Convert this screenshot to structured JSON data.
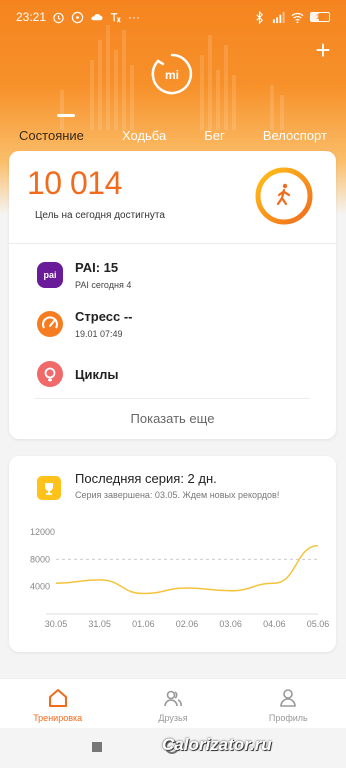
{
  "status_bar": {
    "time": "23:21",
    "more_dots": "···",
    "battery": "16"
  },
  "tabs": [
    {
      "label": "Состояние",
      "active": true
    },
    {
      "label": "Ходьба",
      "active": false
    },
    {
      "label": "Бег",
      "active": false
    },
    {
      "label": "Велоспорт",
      "active": false
    }
  ],
  "steps": {
    "value": "10 014",
    "subtitle": "Цель на сегодня достигнута"
  },
  "rows": [
    {
      "icon": "pai-icon",
      "title": "PAI: 15",
      "subtitle": "PAI сегодня 4",
      "icon_label": "pai"
    },
    {
      "icon": "stress-gauge-icon",
      "title": "Стресс --",
      "subtitle": "19.01 07:49"
    },
    {
      "icon": "cycles-icon",
      "title": "Циклы",
      "subtitle": ""
    }
  ],
  "show_more": "Показать еще",
  "streak": {
    "title": "Последняя серия: 2 дн.",
    "subtitle": "Серия завершена: 03.05. Ждем новых рекордов!"
  },
  "chart_data": {
    "type": "line",
    "x": [
      "30.05",
      "31.05",
      "01.06",
      "02.06",
      "03.06",
      "04.06",
      "05.06"
    ],
    "values": [
      4500,
      5000,
      3000,
      3800,
      3400,
      4500,
      10000
    ],
    "yticks": [
      "12000",
      "8000",
      "4000"
    ],
    "ylim": [
      0,
      12000
    ],
    "goal_line": 8000,
    "xlabel": "",
    "ylabel": ""
  },
  "bottom_nav": [
    {
      "label": "Тренировка",
      "active": true
    },
    {
      "label": "Друзья",
      "active": false
    },
    {
      "label": "Профиль",
      "active": false
    }
  ],
  "watermark": "Calorizator.ru",
  "colors": {
    "accent": "#f26b1d",
    "header": "#f5841f",
    "pai": "#6a1b9a",
    "stress": "#f57c20",
    "cycles": "#f06a6a",
    "chart_line": "#f5c33b"
  }
}
